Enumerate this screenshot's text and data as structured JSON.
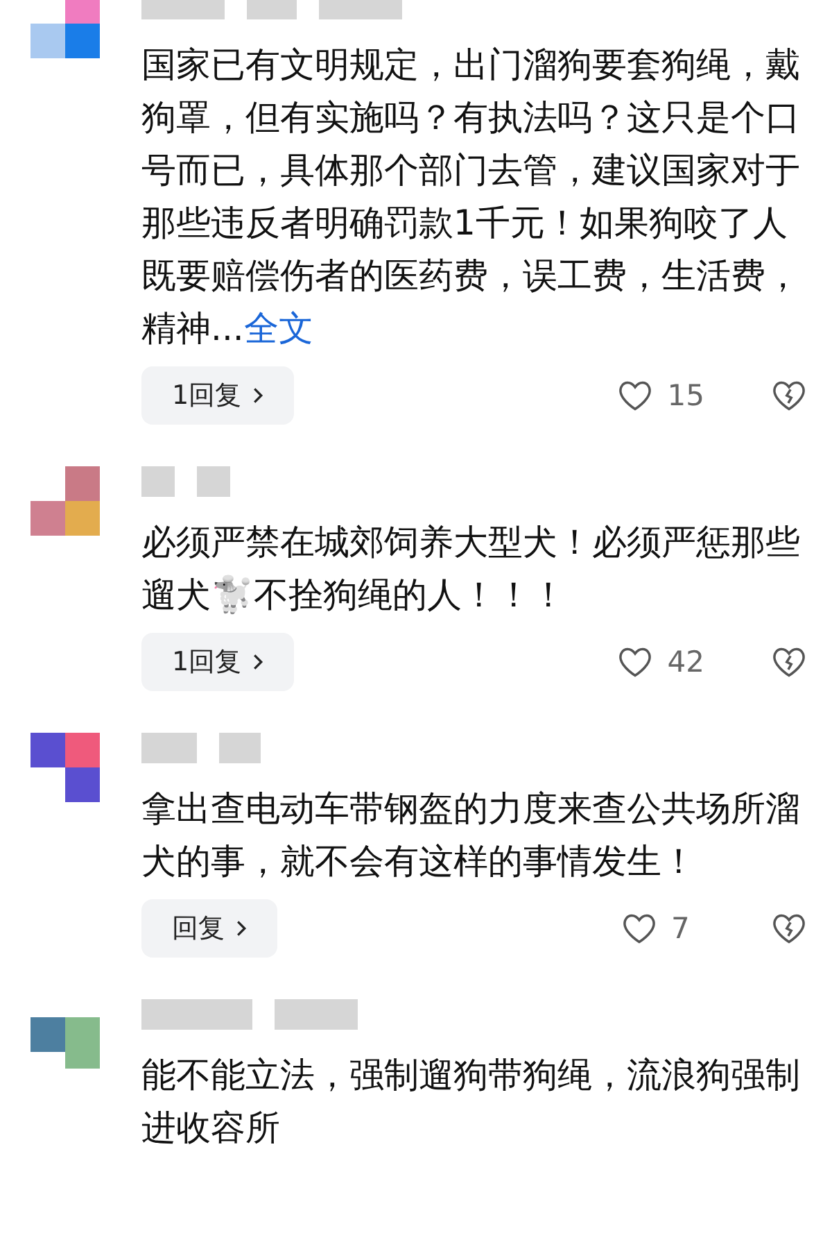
{
  "comments": [
    {
      "text": "国家已有文明规定，出门溜狗要套狗绳，戴狗罩，但有实施吗？有执法吗？这只是个口号而已，具体那个部门去管，建议国家对于那些违反者明确罚款1千元！如果狗咬了人既要赔偿伤者的医药费，误工费，生活费，精神...",
      "more_link": "全文",
      "reply_label": "1回复",
      "likes": "15"
    },
    {
      "text": "必须严禁在城郊饲养大型犬！必须严惩那些遛犬🐩不拴狗绳的人！！！",
      "reply_label": "1回复",
      "likes": "42"
    },
    {
      "text": "拿出查电动车带钢盔的力度来查公共场所溜犬的事，就不会有这样的事情发生！",
      "reply_label": "回复",
      "likes": "7"
    },
    {
      "text": "能不能立法，强制遛狗带狗绳，流浪狗强制进收容所"
    }
  ]
}
